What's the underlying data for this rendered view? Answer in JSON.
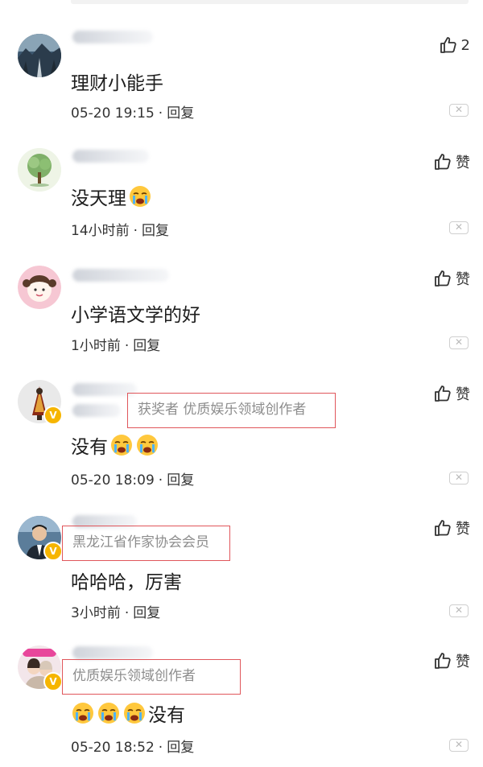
{
  "like_label": "赞",
  "reply_label": "回复",
  "colors": {
    "tag_border": "#e0565b",
    "badge": "#f6b500"
  },
  "comments": [
    {
      "text": "理财小能手",
      "emoji_count": 0,
      "time": "05-20 19:15",
      "likes": "2",
      "avatar_icon": "mountain-road-avatar"
    },
    {
      "text": "没天理",
      "emoji_count": 1,
      "time": "14小时前",
      "likes": "赞",
      "avatar_icon": "tree-avatar"
    },
    {
      "text": "小学语文学的好",
      "emoji_count": 0,
      "time": "1小时前",
      "likes": "赞",
      "avatar_icon": "cartoon-girl-avatar"
    },
    {
      "text": "没有",
      "emoji_count": 2,
      "time": "05-20 18:09",
      "likes": "赞",
      "tag": "获奖者 优质娱乐领域创作者",
      "avatar_icon": "figure-avatar",
      "badge": "V"
    },
    {
      "text": "哈哈哈，厉害",
      "emoji_count": 0,
      "time": "3小时前",
      "likes": "赞",
      "tag": "黑龙江省作家协会会员",
      "avatar_icon": "man-suit-avatar",
      "badge": "V"
    },
    {
      "text": "没有",
      "emoji_count": 3,
      "emoji_first": true,
      "time": "05-20 18:52",
      "likes": "赞",
      "tag": "优质娱乐领域创作者",
      "avatar_icon": "couple-avatar",
      "badge": "V"
    }
  ]
}
